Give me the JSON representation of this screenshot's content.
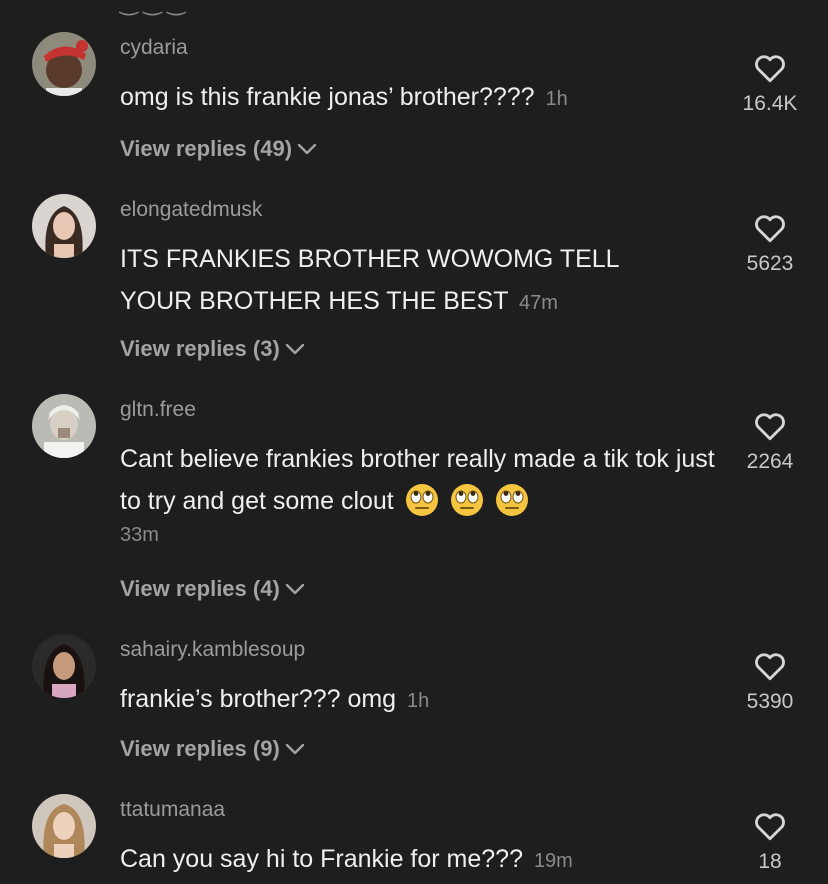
{
  "comments": [
    {
      "username": "cydaria",
      "text": "omg is this frankie jonas’ brother????",
      "time": "1h",
      "likes": "16.4K",
      "replies": "View replies (49)"
    },
    {
      "username": "elongatedmusk",
      "text": "ITS FRANKIES BROTHER WOWOMG TELL YOUR BROTHER HES THE BEST",
      "time": "47m",
      "likes": "5623",
      "replies": "View replies (3)"
    },
    {
      "username": "gltn.free",
      "text": "Cant believe frankies brother really made a tik tok just to try and get some clout",
      "emoji": "🙄🙄🙄",
      "time": "33m",
      "likes": "2264",
      "replies": "View replies (4)"
    },
    {
      "username": "sahairy.kamblesoup",
      "text": "frankie’s brother??? omg",
      "time": "1h",
      "likes": "5390",
      "replies": "View replies (9)"
    },
    {
      "username": "ttatumanaa",
      "text": "Can you say hi to Frankie for me???",
      "time": "19m",
      "likes": "18"
    }
  ],
  "icons": {
    "like": "heart-outline-icon",
    "expand": "chevron-down-icon",
    "emoji": "face-with-rolling-eyes"
  },
  "colors": {
    "background": "#1e1e1e",
    "text": "#efefef",
    "muted": "#9b9b9b"
  }
}
